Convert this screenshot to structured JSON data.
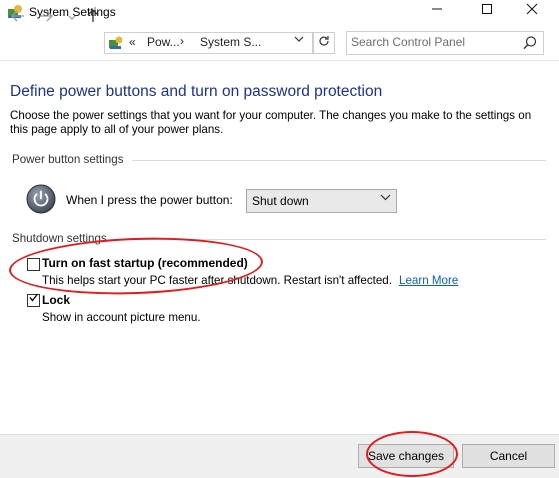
{
  "window": {
    "title": "System Settings"
  },
  "nav": {
    "address_separator": "«",
    "crumb1": "Pow...",
    "crumb2": "System S...",
    "search_placeholder": "Search Control Panel"
  },
  "page": {
    "heading": "Define power buttons and turn on password protection",
    "description": "Choose the power settings that you want for your computer. The changes you make to the settings on this page apply to all of your power plans."
  },
  "power_button_settings": {
    "section_label": "Power button settings",
    "label": "When I press the power button:",
    "selected": "Shut down"
  },
  "shutdown_settings": {
    "section_label": "Shutdown settings",
    "fast_startup": {
      "label": "Turn on fast startup (recommended)",
      "description": "This helps start your PC faster after shutdown. Restart isn't affected.",
      "link": "Learn More",
      "checked": false
    },
    "lock": {
      "label": "Lock",
      "description": "Show in account picture menu.",
      "checked": true
    }
  },
  "footer": {
    "save_label": "Save changes",
    "cancel_label": "Cancel"
  },
  "colors": {
    "heading": "#1e3287",
    "link": "#0b5fc7",
    "annotation": "#e01c1c"
  }
}
